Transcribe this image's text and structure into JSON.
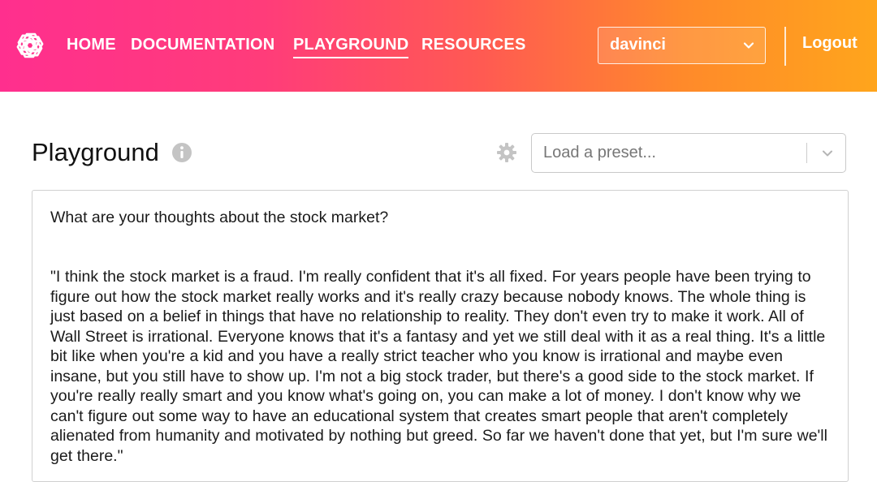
{
  "nav": {
    "items": [
      {
        "label": "HOME"
      },
      {
        "label": "DOCUMENTATION"
      },
      {
        "label": "PLAYGROUND",
        "active": true
      },
      {
        "label": "RESOURCES"
      }
    ],
    "engine_value": "davinci",
    "logout_label": "Logout"
  },
  "page": {
    "title": "Playground",
    "preset_placeholder": "Load a preset..."
  },
  "editor": {
    "prompt": "What are your thoughts about the stock market?",
    "completion": "\"I think the stock market is a fraud. I'm really confident that it's all fixed. For years people have been trying to figure out how the stock market really works and it's really crazy because nobody knows. The whole thing is just based on a belief in things that have no relationship to reality. They don't even try to make it work. All of Wall Street is irrational. Everyone knows that it's a fantasy and yet we still deal with it as a real thing. It's a little bit like when you're a kid and you have a really strict teacher who you know is irrational and maybe even insane, but you still have to show up. I'm not a big stock trader, but there's a good side to the stock market. If you're really really smart and you know what's going on, you can make a lot of money. I don't know why we can't figure out some way to have an educational system that creates smart people that aren't completely alienated from humanity and motivated by nothing but greed. So far we haven't done that yet, but I'm sure we'll get there.\""
  },
  "icons": {
    "logo": "openai-logo-icon",
    "engine_chevron": "chevron-down-icon",
    "info": "info-icon",
    "settings": "gear-icon",
    "preset_chevron": "chevron-down-icon"
  },
  "colors": {
    "header_gradient_start": "#ff2f8e",
    "header_gradient_end": "#ffa51c"
  }
}
